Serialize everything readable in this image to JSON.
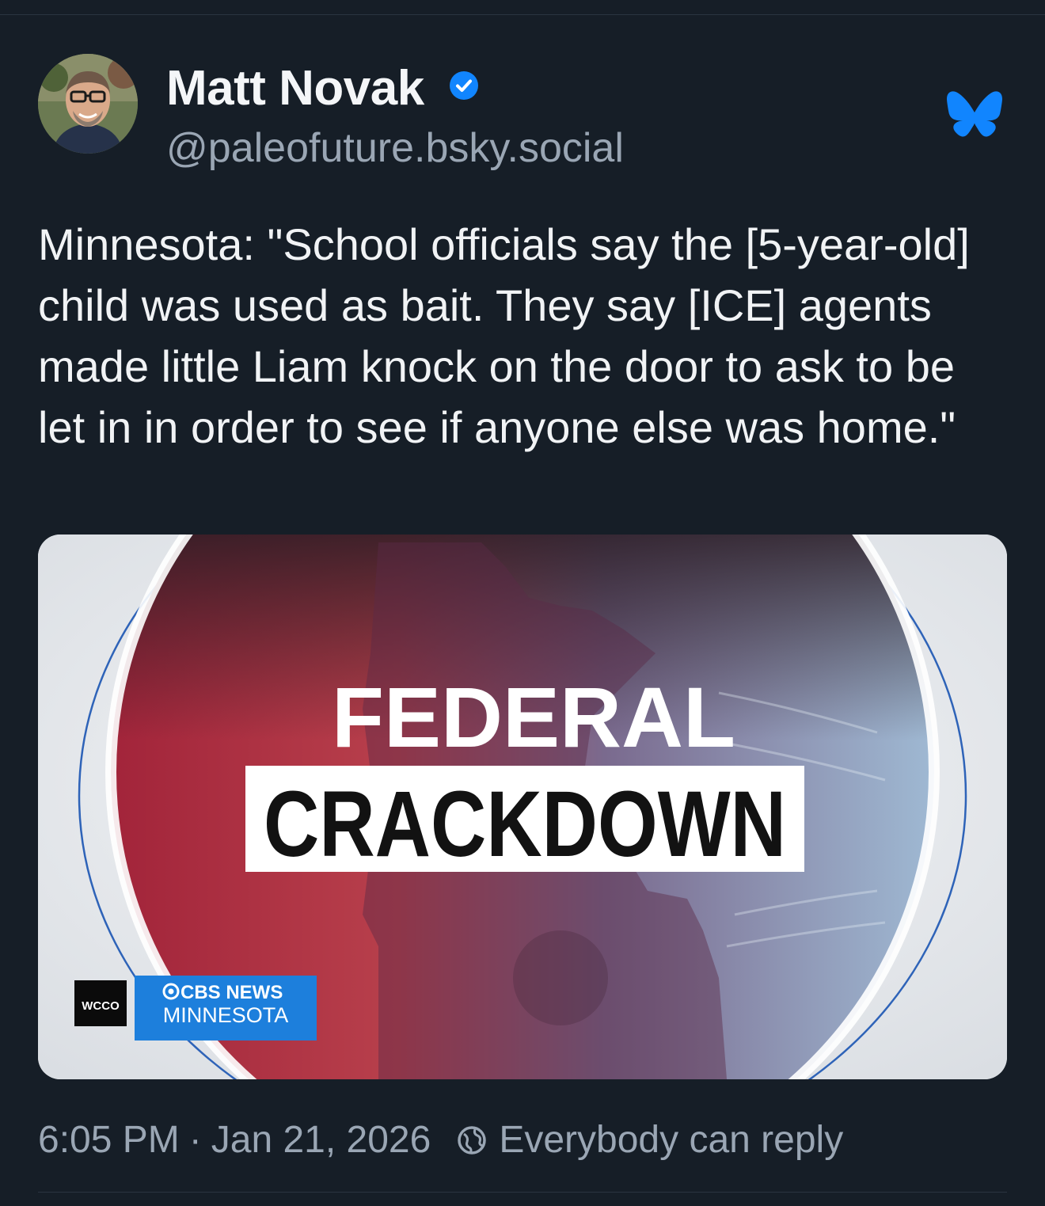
{
  "post": {
    "author": {
      "display_name": "Matt Novak",
      "handle": "@paleofuture.bsky.social",
      "verified": true
    },
    "text": "Minnesota: \"School officials say the [5-year-old] child was used as bait. They say [ICE] agents made little Liam knock on the door to ask to be let in in order to see if anyone else was home.\"",
    "media": {
      "headline_line1": "FEDERAL",
      "headline_line2": "CRACKDOWN",
      "station_badge": "WCCO",
      "network": "CBS NEWS",
      "network_region": "MINNESOTA"
    },
    "time": "6:05 PM",
    "separator": "·",
    "date": "Jan 21, 2026",
    "reply_setting": "Everybody can reply"
  },
  "icons": {
    "verified": "verified-check-icon",
    "platform": "bluesky-butterfly-icon",
    "reply_setting": "globe-icon"
  },
  "colors": {
    "background": "#161e27",
    "text_primary": "#f1f3f5",
    "text_secondary": "#9aa6b4",
    "accent": "#1185fe"
  }
}
